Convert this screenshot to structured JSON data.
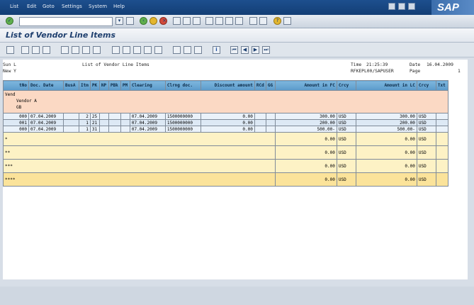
{
  "menu": [
    "List",
    "Edit",
    "Goto",
    "Settings",
    "System",
    "Help"
  ],
  "title": "List of Vendor Line Items",
  "report_header": {
    "left_line1": "Sun L",
    "left_line2": "New Y",
    "center": "List of Vendor Line Items",
    "time_label": "Time",
    "time": "21:25:39",
    "date_label": "Date",
    "date": "16.04.2009",
    "program": "RFKEPL00/SAPUSER",
    "page_label": "Page",
    "page": "1"
  },
  "columns": [
    "tNo",
    "Doc. Date",
    "BusA",
    "Itm",
    "PK",
    "NP",
    "PBk",
    "PM",
    "Clearing",
    "Clrng doc.",
    "Discount amount",
    "RCd",
    "GG",
    "Amount in FC",
    "Crcy",
    "Amount in LC",
    "Crcy",
    "Txt"
  ],
  "group": {
    "label": "Vend",
    "name": "Vendor A",
    "code": "GB"
  },
  "rows": [
    {
      "no": "000",
      "date": "07.04.2009",
      "busa": "",
      "itm": "2",
      "pk": "25",
      "np": "",
      "pbk": "",
      "pm": "",
      "clearing": "07.04.2009",
      "clrdoc": "1500000000",
      "disc": "0.00",
      "rcd": "",
      "gg": "",
      "fc": "300.00",
      "crcy": "USD",
      "lc": "300.00",
      "crcy2": "USD",
      "txt": ""
    },
    {
      "no": "001",
      "date": "07.04.2009",
      "busa": "",
      "itm": "1",
      "pk": "21",
      "np": "",
      "pbk": "",
      "pm": "",
      "clearing": "07.04.2009",
      "clrdoc": "1500000000",
      "disc": "0.00",
      "rcd": "",
      "gg": "",
      "fc": "200.00",
      "crcy": "USD",
      "lc": "200.00",
      "crcy2": "USD",
      "txt": ""
    },
    {
      "no": "000",
      "date": "07.04.2009",
      "busa": "",
      "itm": "1",
      "pk": "31",
      "np": "",
      "pbk": "",
      "pm": "",
      "clearing": "07.04.2009",
      "clrdoc": "1500000000",
      "disc": "0.00",
      "rcd": "",
      "gg": "",
      "fc": "500.00-",
      "crcy": "USD",
      "lc": "500.00-",
      "crcy2": "USD",
      "txt": ""
    }
  ],
  "totals": [
    {
      "level": "*",
      "fc": "0.00",
      "crcy": "USD",
      "lc": "0.00",
      "crcy2": "USD"
    },
    {
      "level": "**",
      "fc": "0.00",
      "crcy": "USD",
      "lc": "0.00",
      "crcy2": "USD"
    },
    {
      "level": "***",
      "fc": "0.00",
      "crcy": "USD",
      "lc": "0.00",
      "crcy2": "USD"
    },
    {
      "level": "****",
      "fc": "0.00",
      "crcy": "USD",
      "lc": "0.00",
      "crcy2": "USD"
    }
  ],
  "logo": "SAP"
}
